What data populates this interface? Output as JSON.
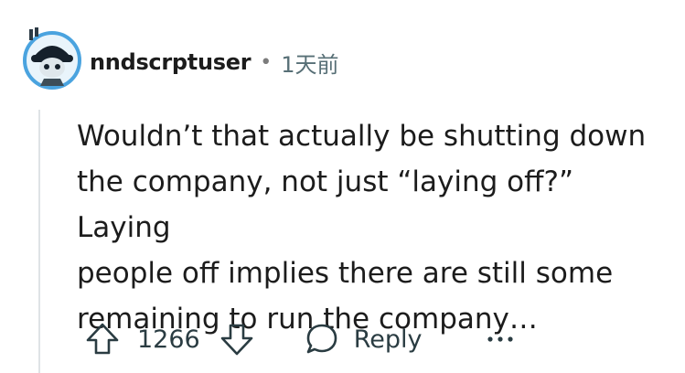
{
  "comment": {
    "username": "nndscrptuser",
    "separator": "•",
    "timestamp": "1天前",
    "lines": [
      "Wouldn’t that actually be shutting down",
      "the company, not just “laying off?” Laying",
      "people off implies there are still some",
      "remaining to run the company…"
    ]
  },
  "actions": {
    "vote_count": "1266",
    "reply_label": "Reply"
  },
  "icons": {
    "avatar": "avatar-robot",
    "upvote": "arrow-up-outline-icon",
    "downvote": "arrow-down-outline-icon",
    "reply": "speech-bubble-icon",
    "more": "ellipsis-icon"
  },
  "colors": {
    "avatar_ring": "#4aa3df",
    "text": "#1c1c1c",
    "meta": "#576f76",
    "action": "#2a3c42"
  }
}
